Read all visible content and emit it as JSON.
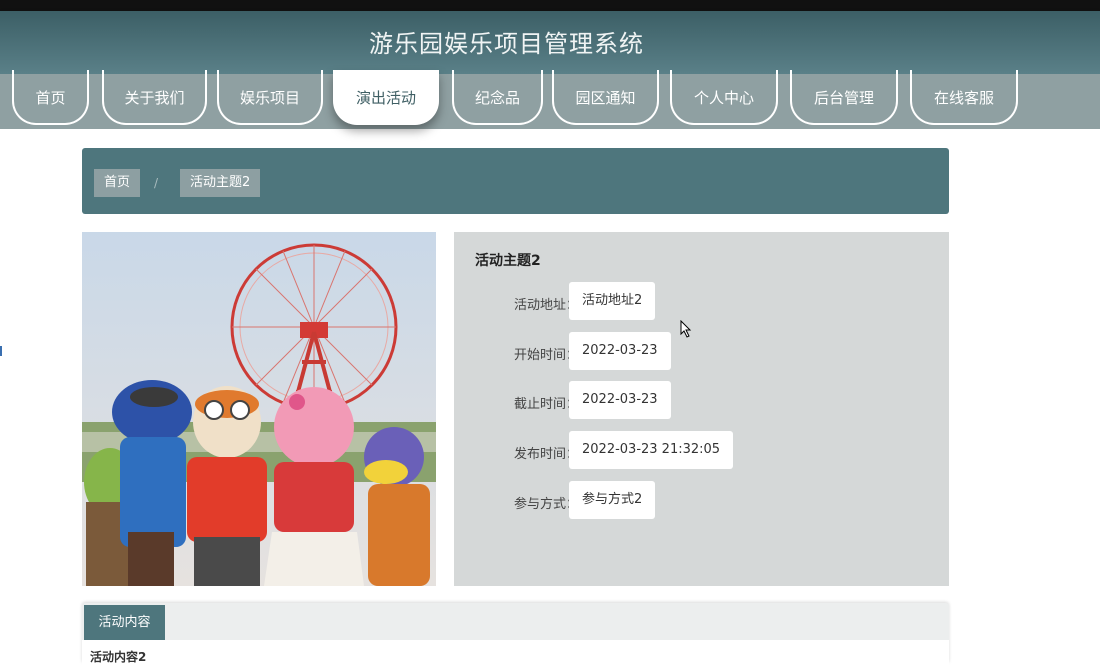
{
  "header": {
    "title": "游乐园娱乐项目管理系统"
  },
  "nav": {
    "items": [
      {
        "label": "首页"
      },
      {
        "label": "关于我们"
      },
      {
        "label": "娱乐项目"
      },
      {
        "label": "演出活动"
      },
      {
        "label": "纪念品"
      },
      {
        "label": "园区通知"
      },
      {
        "label": "个人中心"
      },
      {
        "label": "后台管理"
      },
      {
        "label": "在线客服"
      }
    ],
    "active": "演出活动"
  },
  "breadcrumb": {
    "home": "首页",
    "separator": "/",
    "current": "活动主题2"
  },
  "detail": {
    "title": "活动主题2",
    "rows": [
      {
        "label": "活动地址：",
        "value": "活动地址2"
      },
      {
        "label": "开始时间：",
        "value": "2022-03-23"
      },
      {
        "label": "截止时间：",
        "value": "2022-03-23"
      },
      {
        "label": "发布时间：",
        "value": "2022-03-23 21:32:05"
      },
      {
        "label": "参与方式：",
        "value": "参与方式2"
      }
    ]
  },
  "tabs": {
    "active_label": "活动内容",
    "content_preview": "活动内容2"
  },
  "colors": {
    "header": "#4a6f76",
    "nav": "#8fa0a2",
    "accent": "#4e767d",
    "panel": "#d5d8d8"
  }
}
